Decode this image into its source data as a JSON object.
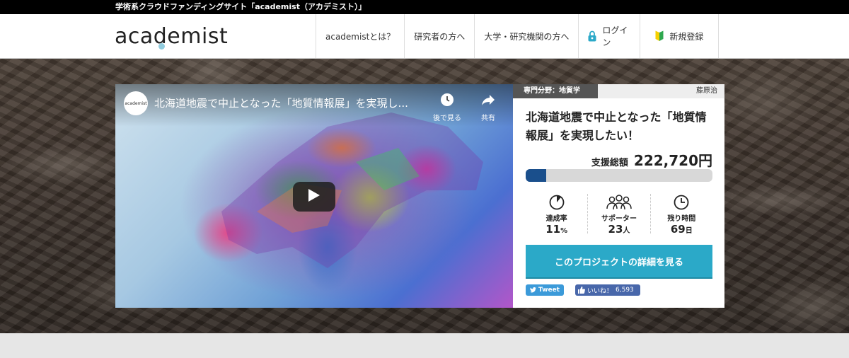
{
  "topbar": {
    "text": "学術系クラウドファンディングサイト「academist（アカデミスト）」"
  },
  "header": {
    "logo": "academist",
    "nav": [
      {
        "label": "academistとは？"
      },
      {
        "label": "研究者の方へ"
      },
      {
        "label": "大学・研究機関の方へ"
      },
      {
        "label": "ログイン",
        "icon": "lock-icon"
      },
      {
        "label": "新規登録",
        "icon": "beginner-mark-icon"
      }
    ]
  },
  "video": {
    "channel_logo": "academist",
    "title": "北海道地震で中止となった「地質情報展」を実現し...",
    "watch_later": "後で見る",
    "share": "共有"
  },
  "project": {
    "category": "専門分野：地質学",
    "owner": "藤原治",
    "title": "北海道地震で中止となった「地質情報展」を実現したい！",
    "total_label": "支援総額",
    "total_amount": "222,720円",
    "progress_fraction": 0.11,
    "accent_color": "#2ba9c8",
    "progress_color": "#1a4f8c",
    "stats": [
      {
        "label": "達成率",
        "value": "11",
        "unit": "%",
        "icon": "pie-chart-icon"
      },
      {
        "label": "サポーター",
        "value": "23",
        "unit": "人",
        "icon": "supporters-icon"
      },
      {
        "label": "残り時間",
        "value": "69",
        "unit": "日",
        "icon": "clock-icon"
      }
    ],
    "cta": "このプロジェクトの詳細を見る",
    "tweet": "Tweet",
    "like": "いいね！",
    "like_count": "6,593"
  }
}
